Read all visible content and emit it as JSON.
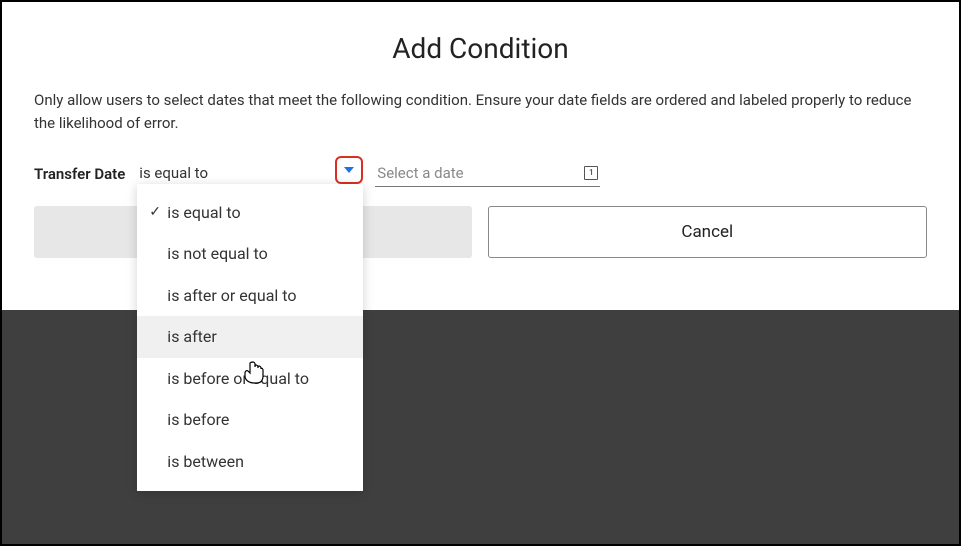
{
  "title": "Add Condition",
  "description": "Only allow users to select dates that meet the following condition. Ensure your date fields are ordered and labeled properly to reduce the likelihood of error.",
  "field_label": "Transfer Date",
  "operator": {
    "selected": "is equal to",
    "options": [
      {
        "label": "is equal to",
        "selected": true,
        "hovered": false
      },
      {
        "label": "is not equal to",
        "selected": false,
        "hovered": false
      },
      {
        "label": "is after or equal to",
        "selected": false,
        "hovered": false
      },
      {
        "label": "is after",
        "selected": false,
        "hovered": true
      },
      {
        "label": "is before or equal to",
        "selected": false,
        "hovered": false
      },
      {
        "label": "is before",
        "selected": false,
        "hovered": false
      },
      {
        "label": "is between",
        "selected": false,
        "hovered": false
      }
    ]
  },
  "date_input": {
    "placeholder": "Select a date",
    "value": ""
  },
  "buttons": {
    "cancel": "Cancel"
  }
}
